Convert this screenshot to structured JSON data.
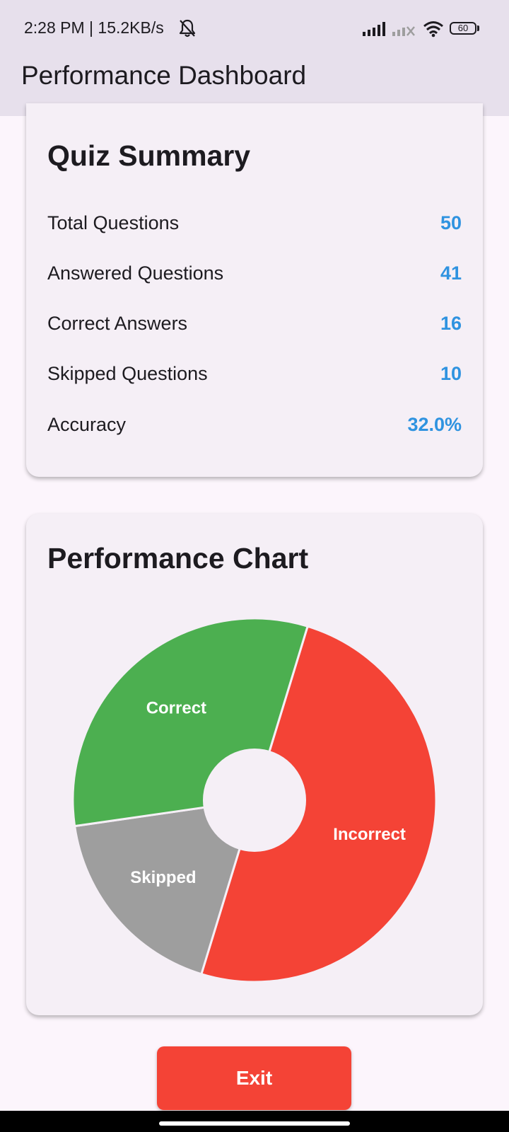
{
  "status_bar": {
    "time_text": "2:28 PM | 15.2KB/s",
    "battery_level": "60",
    "icons": [
      "bell-off-icon",
      "signal-icon",
      "signal-no-service-icon",
      "wifi-icon",
      "battery-icon"
    ]
  },
  "app_bar": {
    "title": "Performance Dashboard"
  },
  "summary": {
    "title": "Quiz Summary",
    "rows": [
      {
        "label": "Total Questions",
        "value": "50"
      },
      {
        "label": "Answered Questions",
        "value": "41"
      },
      {
        "label": "Correct Answers",
        "value": "16"
      },
      {
        "label": "Skipped Questions",
        "value": "10"
      },
      {
        "label": "Accuracy",
        "value": "32.0%"
      }
    ],
    "value_color": "#2f93e0"
  },
  "performance_chart": {
    "title": "Performance Chart"
  },
  "chart_data": {
    "type": "pie",
    "donut": true,
    "categories": [
      "Incorrect",
      "Skipped",
      "Correct"
    ],
    "values": [
      25,
      9,
      16
    ],
    "colors": [
      "#f44336",
      "#9e9e9e",
      "#4caf50"
    ]
  },
  "exit_button": {
    "label": "Exit",
    "color": "#f44336"
  }
}
